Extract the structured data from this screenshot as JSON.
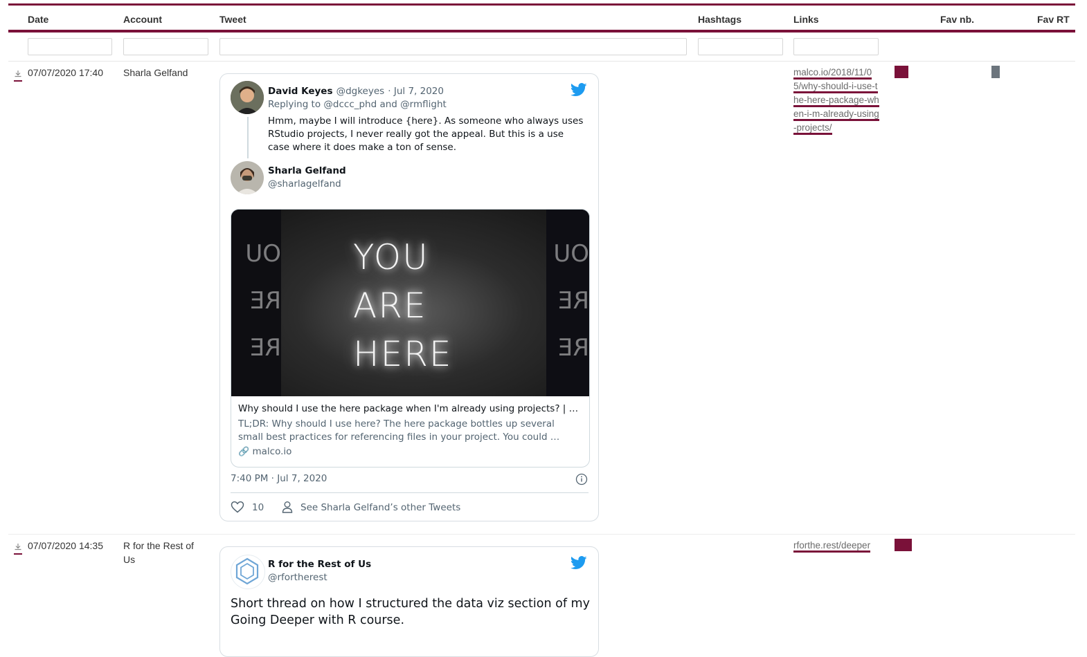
{
  "columns": [
    "Date",
    "Account",
    "Tweet",
    "Hashtags",
    "Links",
    "Fav nb.",
    "Fav RT"
  ],
  "filters": {
    "date": "",
    "account": "",
    "tweet": "",
    "hashtags": "",
    "links": ""
  },
  "rows": [
    {
      "date": "07/07/2020 17:40",
      "account": "Sharla Gelfand",
      "link": "malco.io/2018/11/05/why-should-i-use-the-here-package-when-i-m-already-using-projects/",
      "fav_color": "#7a1139",
      "rt_color": "#6c757d",
      "tweet": {
        "reply": {
          "name": "David Keyes",
          "handle": "@dgkeyes",
          "date": "· Jul 7, 2020",
          "replying": "Replying to @dccc_phd and @rmflight",
          "text": "Hmm, maybe I will introduce {here}. As someone who always uses RStudio projects, I never really got the appeal. But this is a use case where it does make a ton of sense."
        },
        "author": {
          "name": "Sharla Gelfand",
          "handle": "@sharlagelfand"
        },
        "media_text": [
          "YOU",
          "ARE",
          "HERE"
        ],
        "card": {
          "title": "Why should I use the here package when I'm already using projects? | …",
          "description": "TL;DR: Why should I use here? The here package bottles up several small best practices for referencing files in your project. You could …",
          "domain": "malco.io"
        },
        "timestamp": "7:40 PM · Jul 7, 2020",
        "likes": "10",
        "other_tweets": "See Sharla Gelfand’s other Tweets"
      }
    },
    {
      "date": "07/07/2020 14:35",
      "account": "R for the Rest of Us",
      "link": "rforthe.rest/deeper",
      "fav_color": "#7a1139",
      "tweet": {
        "author": {
          "name": "R for the Rest of Us",
          "handle": "@rfortherest"
        },
        "text": "Short thread on how I structured the data viz section of my Going Deeper with R course."
      }
    }
  ]
}
